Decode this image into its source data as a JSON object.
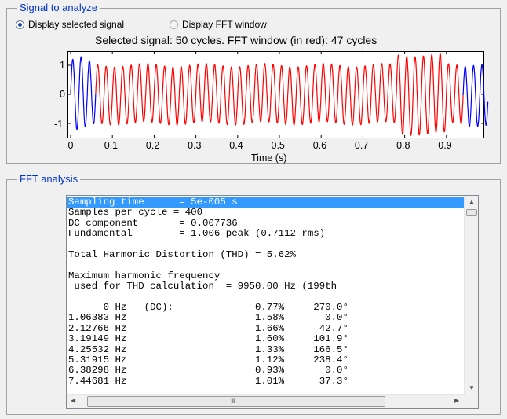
{
  "signal_panel": {
    "title": "Signal to analyze",
    "radio_selected": "Display selected signal",
    "radio_fft": "Display FFT window",
    "plot_title": "Selected signal: 50 cycles. FFT window (in red): 47 cycles",
    "yticks": [
      "1",
      "0",
      "-1"
    ],
    "xticks": [
      "0",
      "0.1",
      "0.2",
      "0.3",
      "0.4",
      "0.5",
      "0.6",
      "0.7",
      "0.8",
      "0.9"
    ],
    "xlabel": "Time (s)",
    "colors": {
      "selected_signal": "#0000ff",
      "fft_window": "#ff0000"
    }
  },
  "fft_panel": {
    "title": "FFT analysis",
    "lines": [
      "Sampling time      = 5e-005 s",
      "Samples per cycle = 400",
      "DC component       = 0.007736",
      "Fundamental        = 1.006 peak (0.7112 rms)",
      "",
      "Total Harmonic Distortion (THD) = 5.62%",
      "",
      "Maximum harmonic frequency",
      " used for THD calculation  = 9950.00 Hz (199th",
      "",
      "      0 Hz   (DC):              0.77%     270.0°",
      "1.06383 Hz                      1.58%       0.0°",
      "2.12766 Hz                      1.66%      42.7°",
      "3.19149 Hz                      1.60%     101.9°",
      "4.25532 Hz                      1.33%     166.5°",
      "5.31915 Hz                      1.12%     238.4°",
      "6.38298 Hz                      0.93%       0.0°",
      "7.44681 Hz                      1.01%      37.3°"
    ],
    "scroll_grip": "III"
  }
}
